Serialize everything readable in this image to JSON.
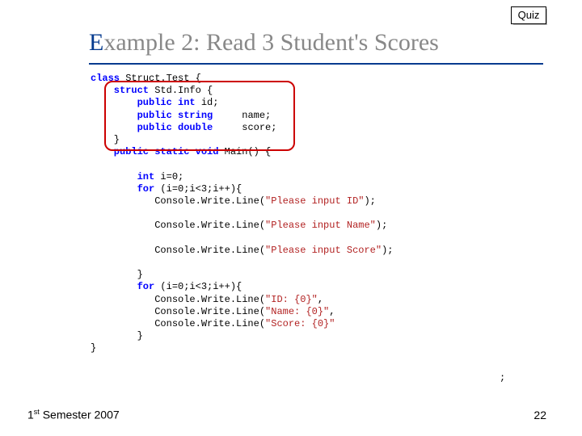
{
  "quiz_label": "Quiz",
  "title_first": "E",
  "title_rest": "xample 2: Read 3 Student's Scores",
  "code": {
    "l1_a": "class",
    "l1_b": " Struct.Test {",
    "l2_a": "    struct",
    "l2_b": " Std.Info {",
    "l3_a": "        public int",
    "l3_b": " id;",
    "l4_a": "        public string",
    "l4_b": "     name;",
    "l5_a": "        public double",
    "l5_b": "     score;",
    "l6": "    }",
    "l7_a": "    public static void",
    "l7_b": " Main() {",
    "blank1": "",
    "l8_a": "        int",
    "l8_b": " i=0;",
    "l9_a": "        for",
    "l9_b": " (i=0;i<3;i++){",
    "l10_a": "           Console.Write.Line(",
    "l10_s": "\"Please input ID\"",
    "l10_b": ");",
    "blank2": "",
    "l11_a": "           Console.Write.Line(",
    "l11_s": "\"Please input Name\"",
    "l11_b": ");",
    "blank3": "",
    "l12_a": "           Console.Write.Line(",
    "l12_s": "\"Please input Score\"",
    "l12_b": ");",
    "blank4": "",
    "l13": "        }",
    "l14_a": "        for",
    "l14_b": " (i=0;i<3;i++){",
    "l15_a": "           Console.Write.Line(",
    "l15_s": "\"ID: {0}\"",
    "l15_b": ",",
    "l16_a": "           Console.Write.Line(",
    "l16_s": "\"Name: {0}\"",
    "l16_b": ",",
    "l17_a": "           Console.Write.Line(",
    "l17_s": "\"Score: {0}\"",
    "l17_b": "",
    "l18": "        }",
    "l19": "}"
  },
  "stray": ";",
  "footer_left_pre": "1",
  "footer_left_sup": "st",
  "footer_left_post": " Semester 2007",
  "page_num": "22"
}
